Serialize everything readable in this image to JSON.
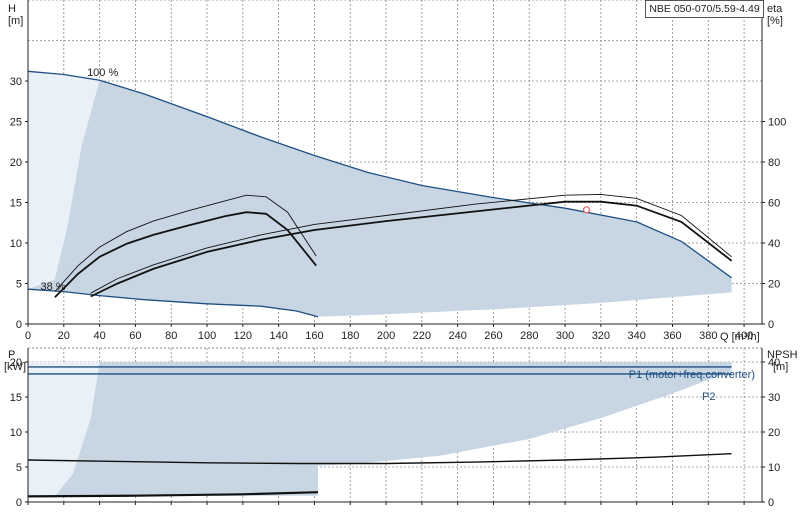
{
  "model_label": "NBE 050-070/5.59-4.49",
  "chart_data": [
    {
      "type": "line",
      "title": "",
      "xlabel": "Q [m³/h]",
      "ylabel_left": "H [m]",
      "ylabel_right": "eta [%]",
      "xlim": [
        0,
        410
      ],
      "ylim_left": [
        0,
        40
      ],
      "ylim_right": [
        0,
        160
      ],
      "x_ticks": [
        0,
        20,
        40,
        60,
        80,
        100,
        120,
        140,
        160,
        180,
        200,
        220,
        240,
        260,
        280,
        300,
        320,
        340,
        360,
        380,
        400
      ],
      "y_ticks_left": [
        0,
        5,
        10,
        15,
        20,
        25,
        30
      ],
      "y_ticks_right": [
        0,
        20,
        40,
        60,
        80,
        100
      ],
      "grid": true,
      "annotations": [
        {
          "text": "100 %",
          "x": 33,
          "y": 30.6
        },
        {
          "text": "38 %",
          "x": 7,
          "y": 4.2
        }
      ],
      "colors": {
        "region": "#c8d6e3",
        "region_light": "#e9f0f7",
        "max_curve": "#1f4f82",
        "curve": "#111111",
        "duty_point": "#e06060"
      },
      "region_max_speed": {
        "x": [
          0,
          20,
          40,
          65,
          100,
          130,
          160,
          190,
          220,
          260,
          300,
          340,
          365,
          393
        ],
        "y": [
          31.2,
          30.8,
          30.1,
          28.4,
          25.6,
          23.1,
          20.8,
          18.7,
          17.1,
          15.6,
          14.3,
          12.6,
          10.2,
          5.7
        ]
      },
      "region_min_speed": {
        "x": [
          0,
          20,
          40,
          65,
          100,
          130,
          150,
          162
        ],
        "y": [
          4.3,
          4.0,
          3.5,
          3.0,
          2.5,
          2.2,
          1.6,
          0.9
        ]
      },
      "region_bottom": {
        "x": [
          162,
          200,
          260,
          320,
          393
        ],
        "y": [
          0.9,
          1.2,
          1.8,
          2.6,
          3.9
        ]
      },
      "series": [
        {
          "kind": "head",
          "x": [
            15,
            28,
            40,
            55,
            70,
            90,
            110,
            122,
            133,
            145,
            161
          ],
          "y": [
            3.3,
            6.2,
            8.3,
            9.9,
            11.0,
            12.2,
            13.3,
            13.8,
            13.6,
            11.6,
            7.2
          ]
        },
        {
          "kind": "head",
          "x": [
            15,
            28,
            40,
            55,
            70,
            90,
            110,
            122,
            133,
            145,
            161
          ],
          "y": [
            4.0,
            7.2,
            9.5,
            11.4,
            12.7,
            14.0,
            15.2,
            15.9,
            15.7,
            13.8,
            8.4
          ]
        },
        {
          "kind": "head",
          "x": [
            35,
            50,
            70,
            100,
            130,
            160,
            200,
            250,
            300,
            320,
            340,
            365,
            393
          ],
          "y": [
            3.4,
            5.0,
            6.8,
            8.9,
            10.4,
            11.6,
            12.7,
            13.9,
            15.1,
            15.1,
            14.6,
            12.6,
            7.8
          ]
        },
        {
          "kind": "head",
          "x": [
            35,
            50,
            70,
            100,
            130,
            160,
            200,
            250,
            300,
            320,
            340,
            365,
            393
          ],
          "y": [
            3.8,
            5.6,
            7.3,
            9.4,
            11.0,
            12.3,
            13.4,
            14.8,
            15.9,
            16.0,
            15.5,
            13.4,
            8.3
          ]
        }
      ],
      "duty_point": {
        "x": 312,
        "y": 14.1
      }
    },
    {
      "type": "line",
      "title": "",
      "ylabel_left": "P [kW]",
      "ylabel_right": "NPSH [m]",
      "xlim": [
        0,
        410
      ],
      "ylim_left": [
        0,
        22
      ],
      "ylim_right": [
        0,
        44
      ],
      "y_ticks_left": [
        0,
        5,
        10,
        15,
        20
      ],
      "y_ticks_right": [
        0,
        10,
        20,
        30,
        40
      ],
      "grid": true,
      "region_top": 20,
      "region_left_x": [
        0,
        15,
        25,
        35,
        40
      ],
      "region_left_y": [
        0.9,
        0.9,
        4,
        12,
        20
      ],
      "region_right_x": [
        393,
        360,
        320,
        280,
        230,
        180,
        162
      ],
      "region_right_y": [
        18.7,
        15.5,
        12,
        9,
        6.6,
        5.4,
        5.2
      ],
      "series": [
        {
          "name": "P1 (motor+freq.converter)",
          "x": [
            0,
            393
          ],
          "y": [
            19.3,
            19.3
          ],
          "color": "#1f4f82"
        },
        {
          "name": "P2",
          "x": [
            0,
            393
          ],
          "y": [
            18.3,
            18.3
          ],
          "color": "#1f4f82"
        },
        {
          "kind": "npsh",
          "x": [
            0,
            50,
            100,
            150,
            200,
            250,
            300,
            350,
            393
          ],
          "y": [
            6.0,
            5.8,
            5.6,
            5.5,
            5.5,
            5.7,
            6.0,
            6.4,
            6.9
          ],
          "color": "#111111"
        },
        {
          "kind": "power",
          "x": [
            0,
            60,
            120,
            162
          ],
          "y": [
            0.8,
            0.9,
            1.1,
            1.4
          ],
          "color": "#111111"
        }
      ]
    }
  ]
}
